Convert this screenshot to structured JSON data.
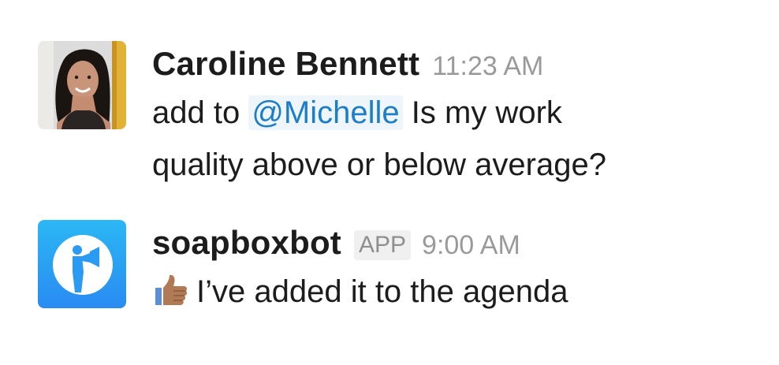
{
  "messages": [
    {
      "sender": "Caroline Bennett",
      "timestamp": "11:23 AM",
      "text_prefix": "add to ",
      "mention": "@Michelle",
      "text_line1_suffix": " Is my work",
      "text_line2": "quality above or below average?"
    },
    {
      "sender": "soapboxbot",
      "badge": "APP",
      "timestamp": "9:00 AM",
      "emoji": "thumbs-up-icon",
      "text": "I’ve added it to the agenda"
    }
  ],
  "colors": {
    "mention": "#1d7ec6",
    "mention_bg": "#eef6fb",
    "timestamp": "#9a9a9a",
    "bot_avatar_top": "#2bb7f5",
    "bot_avatar_bottom": "#2a8bf1"
  }
}
